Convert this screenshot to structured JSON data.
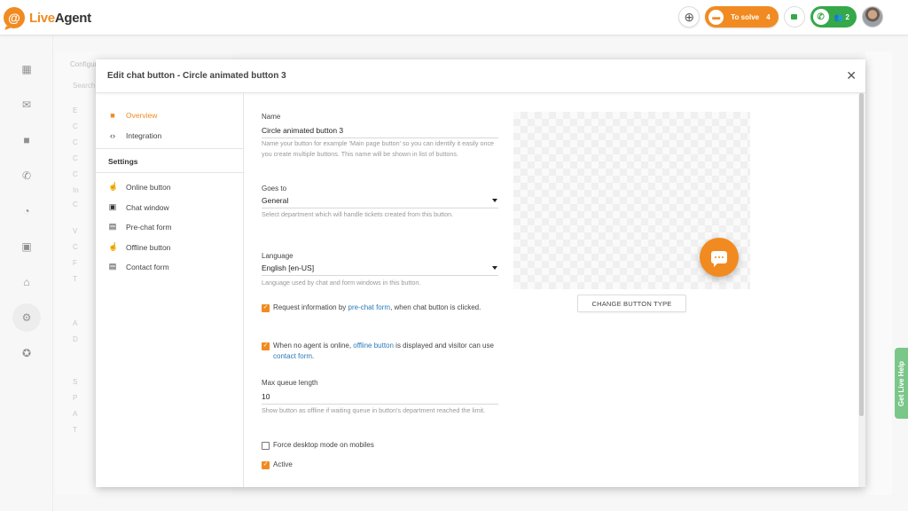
{
  "app": {
    "logo_left": "Live",
    "logo_right": "Agent"
  },
  "topbar": {
    "to_solve_label": "To solve",
    "to_solve_count": "4",
    "calls_count": "2"
  },
  "background": {
    "title": "Configuration",
    "search_placeholder": "Search",
    "rows": [
      "E",
      "C",
      "C",
      "C",
      "C",
      "In",
      "C",
      "V",
      "C",
      "F",
      "T",
      "A",
      "D",
      "S",
      "P",
      "A",
      "T"
    ]
  },
  "help_tab": "Get Live Help",
  "modal": {
    "title": "Edit chat button - Circle animated button 3",
    "nav": {
      "overview": "Overview",
      "integration": "Integration",
      "settings_heading": "Settings",
      "online_button": "Online button",
      "chat_window": "Chat window",
      "pre_chat_form": "Pre-chat form",
      "offline_button": "Offline button",
      "contact_form": "Contact form"
    },
    "form": {
      "name_label": "Name",
      "name_value": "Circle animated button 3",
      "name_help": "Name your button for example 'Main page button' so you can identify it easily once you create multiple buttons. This name will be shown in list of buttons.",
      "goes_to_label": "Goes to",
      "goes_to_value": "General",
      "goes_to_help": "Select department which will handle tickets created from this button.",
      "language_label": "Language",
      "language_value": "English [en-US]",
      "language_help": "Language used by chat and form windows in this button.",
      "request_info": {
        "before": "Request information by ",
        "link": "pre-chat form",
        "after": ", when chat button is clicked.",
        "checked": true
      },
      "offline_info": {
        "before": "When no agent is online, ",
        "link1": "offline button",
        "mid": " is displayed and visitor can use ",
        "link2": "contact form",
        "after": ".",
        "checked": true
      },
      "max_queue_label": "Max queue length",
      "max_queue_value": "10",
      "max_queue_help": "Show button as offline if waiting queue in button's department reached the limit.",
      "force_desktop": {
        "label": "Force desktop mode on mobiles",
        "checked": false
      },
      "active": {
        "label": "Active",
        "checked": true
      }
    },
    "change_button_type": "CHANGE BUTTON TYPE"
  },
  "colors": {
    "accent": "#f18b21",
    "green": "#35a84a",
    "link": "#2a7ab8"
  }
}
